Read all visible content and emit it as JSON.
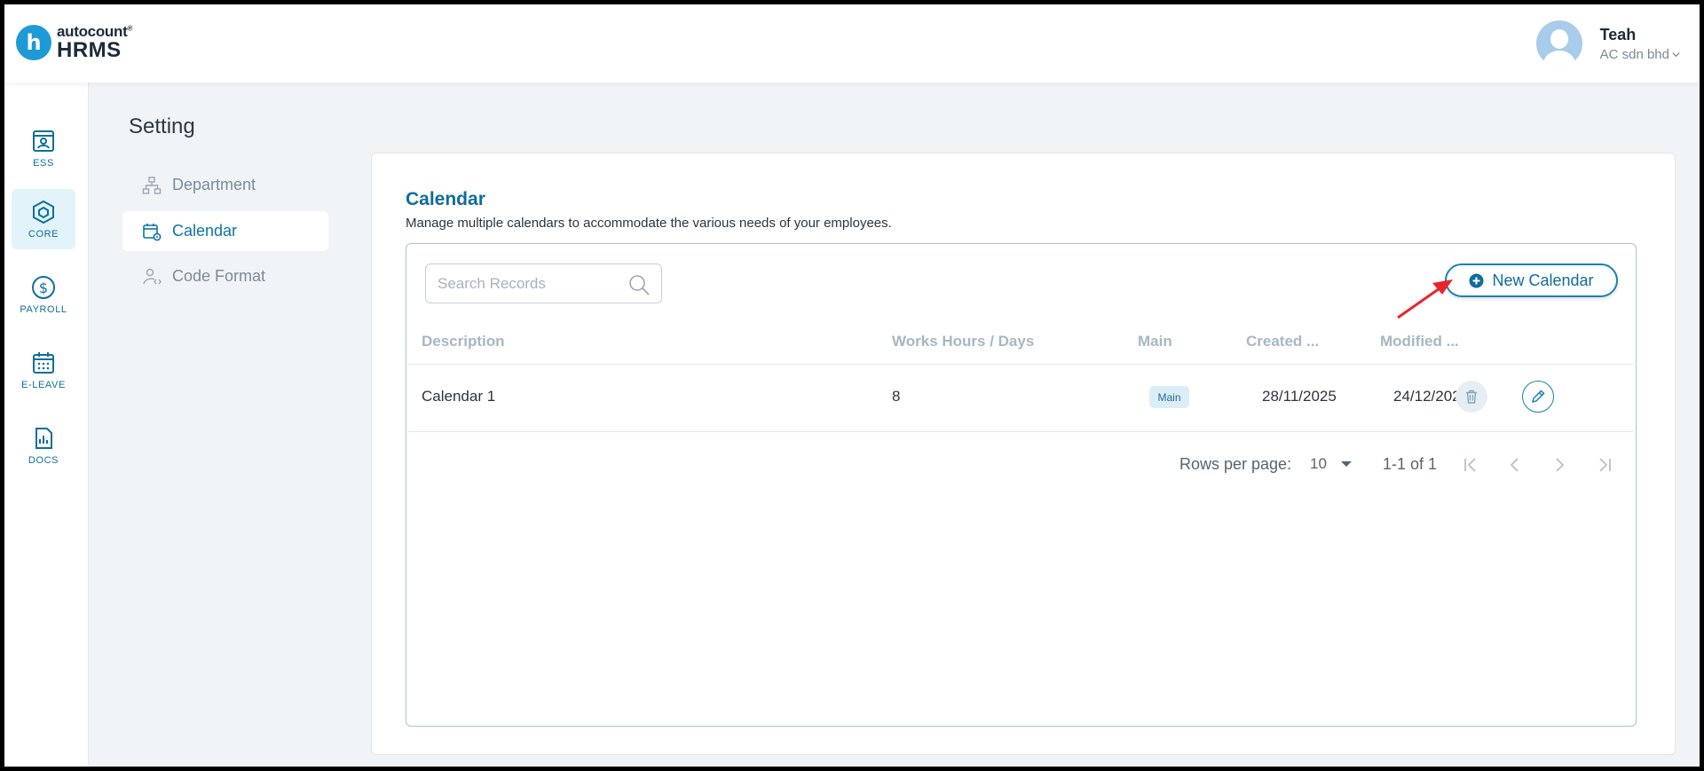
{
  "app": {
    "logo_top": "autocount",
    "logo_bottom": "HRMS"
  },
  "user": {
    "name": "Teah",
    "org": "AC sdn bhd"
  },
  "rail": {
    "items": [
      {
        "label": "ESS",
        "icon": "ess-icon"
      },
      {
        "label": "CORE",
        "icon": "core-icon"
      },
      {
        "label": "PAYROLL",
        "icon": "payroll-icon"
      },
      {
        "label": "E-LEAVE",
        "icon": "calendar-grid-icon"
      },
      {
        "label": "DOCS",
        "icon": "docs-icon"
      }
    ],
    "active": "CORE"
  },
  "page": {
    "title": "Setting"
  },
  "submenu": {
    "items": [
      {
        "label": "Department",
        "icon": "org-chart-icon"
      },
      {
        "label": "Calendar",
        "icon": "calendar-gear-icon"
      },
      {
        "label": "Code Format",
        "icon": "user-code-icon"
      }
    ],
    "active": "Calendar"
  },
  "card": {
    "title": "Calendar",
    "subtitle": "Manage multiple calendars to accommodate the various needs of your employees."
  },
  "search": {
    "placeholder": "Search Records",
    "value": ""
  },
  "toolbar": {
    "new_label": "New Calendar"
  },
  "table": {
    "columns": [
      "Description",
      "Works Hours / Days",
      "Main",
      "Created ...",
      "Modified ..."
    ],
    "rows": [
      {
        "description": "Calendar 1",
        "work_hours": "8",
        "main": "Main",
        "created": "28/11/2025",
        "modified": "24/12/2025"
      }
    ]
  },
  "pagination": {
    "rows_label": "Rows per page:",
    "rows_value": "10",
    "range": "1-1 of 1"
  },
  "colors": {
    "accent": "#0f6c9b",
    "brand": "#1e9ad6",
    "annotation": "#e8262a"
  }
}
